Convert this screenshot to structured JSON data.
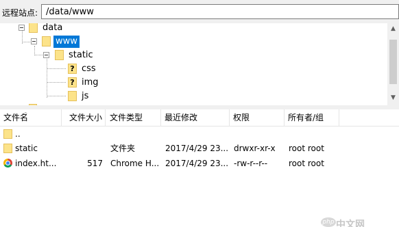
{
  "site": {
    "label": "远程站点:",
    "path": "/data/www"
  },
  "tree": {
    "items": [
      {
        "label": "data",
        "icon": "folder-icon"
      },
      {
        "label": "www",
        "icon": "folder-icon",
        "selected": true
      },
      {
        "label": "static",
        "icon": "folder-icon"
      },
      {
        "label": "css",
        "icon": "unknown-folder-icon",
        "mark": "?"
      },
      {
        "label": "img",
        "icon": "unknown-folder-icon",
        "mark": "?"
      },
      {
        "label": "js",
        "icon": "folder-icon"
      }
    ],
    "scroll_up": "▲",
    "scroll_down": "▼"
  },
  "columns": {
    "name": "文件名",
    "size": "文件大小",
    "type": "文件类型",
    "modified": "最近修改",
    "perms": "权限",
    "owner": "所有者/组",
    "sort_indicator": "^"
  },
  "files": [
    {
      "name": "..",
      "size": "",
      "type": "",
      "modified": "",
      "perms": "",
      "owner": "",
      "icon": "folder-icon"
    },
    {
      "name": "static",
      "size": "",
      "type": "文件夹",
      "modified": "2017/4/29 23...",
      "perms": "drwxr-xr-x",
      "owner": "root root",
      "icon": "folder-icon"
    },
    {
      "name": "index.ht...",
      "size": "517",
      "type": "Chrome H...",
      "modified": "2017/4/29 23...",
      "perms": "-rw-r--r--",
      "owner": "root root",
      "icon": "chrome-icon"
    }
  ],
  "watermark": {
    "badge": "php",
    "text": "中文网"
  },
  "colors": {
    "selection": "#0078d7",
    "folder": "#fce38a"
  }
}
